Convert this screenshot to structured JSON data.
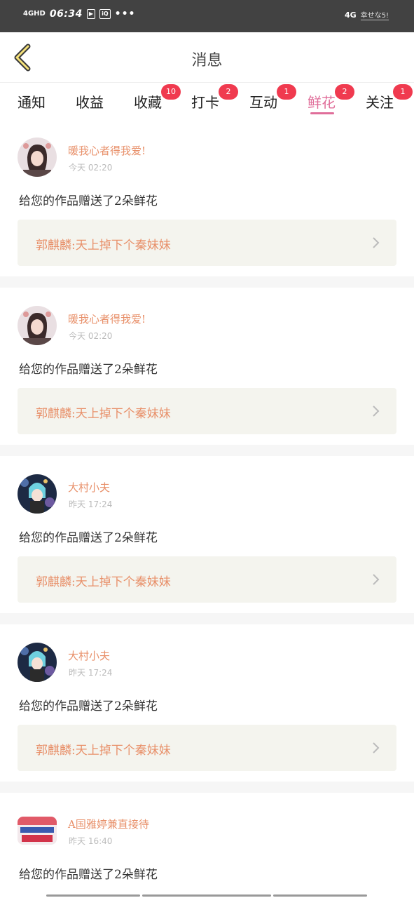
{
  "status_bar": {
    "network": "4GHD",
    "time": "06:34",
    "icons": [
      "video-icon",
      "iqiyi-icon"
    ],
    "more": "•••",
    "signal_label": "4G",
    "carrier_label": "幸せな5!"
  },
  "header": {
    "title": "消息",
    "back_icon": "chevron-left-icon"
  },
  "tabs": [
    {
      "label": "通知",
      "badge": ""
    },
    {
      "label": "收益",
      "badge": ""
    },
    {
      "label": "收藏",
      "badge": "10"
    },
    {
      "label": "打卡",
      "badge": "2"
    },
    {
      "label": "互动",
      "badge": "1"
    },
    {
      "label": "鲜花",
      "badge": "2",
      "active": true
    },
    {
      "label": "关注",
      "badge": "1"
    }
  ],
  "colors": {
    "accent": "#e06e9a",
    "name": "#e8906a",
    "badge": "#f03a4f",
    "work_bg": "#f4f4ee"
  },
  "messages": [
    {
      "user": "暖我心者得我爱!",
      "time": "今天 02:20",
      "text": "给您的作品赠送了2朵鲜花",
      "work": "郭麒麟:天上掉下个秦妹妹",
      "avatar": "avatar-girl"
    },
    {
      "user": "暖我心者得我爱!",
      "time": "今天 02:20",
      "text": "给您的作品赠送了2朵鲜花",
      "work": "郭麒麟:天上掉下个秦妹妹",
      "avatar": "avatar-girl"
    },
    {
      "user": "大村小夫",
      "time": "昨天 17:24",
      "text": "给您的作品赠送了2朵鲜花",
      "work": "郭麒麟:天上掉下个秦妹妹",
      "avatar": "avatar-anime"
    },
    {
      "user": "大村小夫",
      "time": "昨天 17:24",
      "text": "给您的作品赠送了2朵鲜花",
      "work": "郭麒麟:天上掉下个秦妹妹",
      "avatar": "avatar-anime"
    },
    {
      "user": "A国雅婷兼直接待",
      "time": "昨天 16:40",
      "text": "给您的作品赠送了2朵鲜花",
      "work": "",
      "avatar": "avatar-poster"
    }
  ]
}
